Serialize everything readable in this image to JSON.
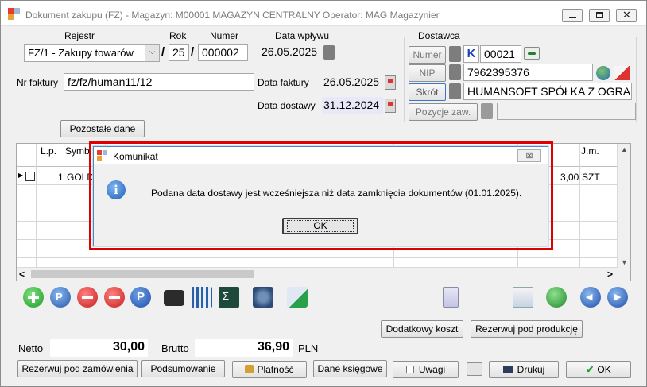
{
  "window": {
    "title": "Dokument zakupu (FZ) - Magazyn: M00001 MAGAZYN CENTRALNY  Operator: MAG Magazynier"
  },
  "header": {
    "rejestr_label": "Rejestr",
    "rok_label": "Rok",
    "numer_label": "Numer",
    "data_wplywu_label": "Data wpływu",
    "rejestr_value": "FZ/1   - Zakupy towarów",
    "slash1": "/",
    "rok_value": "25",
    "slash2": "/",
    "numer_value": "000002",
    "data_wplywu_value": "26.05.2025",
    "nr_faktury_label": "Nr faktury",
    "nr_faktury_value": "fz/fz/human11/12",
    "data_faktury_label": "Data faktury",
    "data_faktury_value": "26.05.2025",
    "data_dostawy_label": "Data dostawy",
    "data_dostawy_value": "31.12.2024",
    "pozostale_label": "Pozostałe dane"
  },
  "dostawca": {
    "group_label": "Dostawca",
    "numer_label": "Numer",
    "k_label": "K",
    "numer_value": "00021",
    "nip_label": "NIP",
    "nip_value": "7962395376",
    "skrot_label": "Skrót",
    "skrot_value": "HUMANSOFT SPÓŁKA Z OGRA",
    "pozycje_label": "Pozycje zaw."
  },
  "grid": {
    "col_lp": "L.p.",
    "col_symbol": "Symb",
    "col_jm": "J.m.",
    "row1_lp": "1",
    "row1_symbol": "GOLD",
    "row1_qty": "3,00",
    "row1_jm": "SZT",
    "scroll_left": "<",
    "scroll_right": ">"
  },
  "dialog": {
    "title": "Komunikat",
    "close": "⊠",
    "message": "Podana data dostawy jest wcześniejsza niż data zamknięcia dokumentów (01.01.2025).",
    "ok_label": "OK"
  },
  "actions": {
    "dodatkowy_koszt": "Dodatkowy koszt",
    "rezerwuj_produkcje": "Rezerwuj pod produkcję"
  },
  "totals": {
    "netto_label": "Netto",
    "netto_value": "30,00",
    "brutto_label": "Brutto",
    "brutto_value": "36,90",
    "currency": "PLN"
  },
  "footer": {
    "rezerwuj_zamowienia": "Rezerwuj pod zamówienia",
    "podsumowanie": "Podsumowanie",
    "platnosc": "Płatność",
    "dane_ksiegowe": "Dane księgowe",
    "uwagi": "Uwagi",
    "drukuj": "Drukuj",
    "ok": "OK"
  },
  "colors": {
    "accent_blue": "#1f5fb4",
    "alert_red": "#e10000",
    "date_highlight": "#e8e8f8"
  }
}
